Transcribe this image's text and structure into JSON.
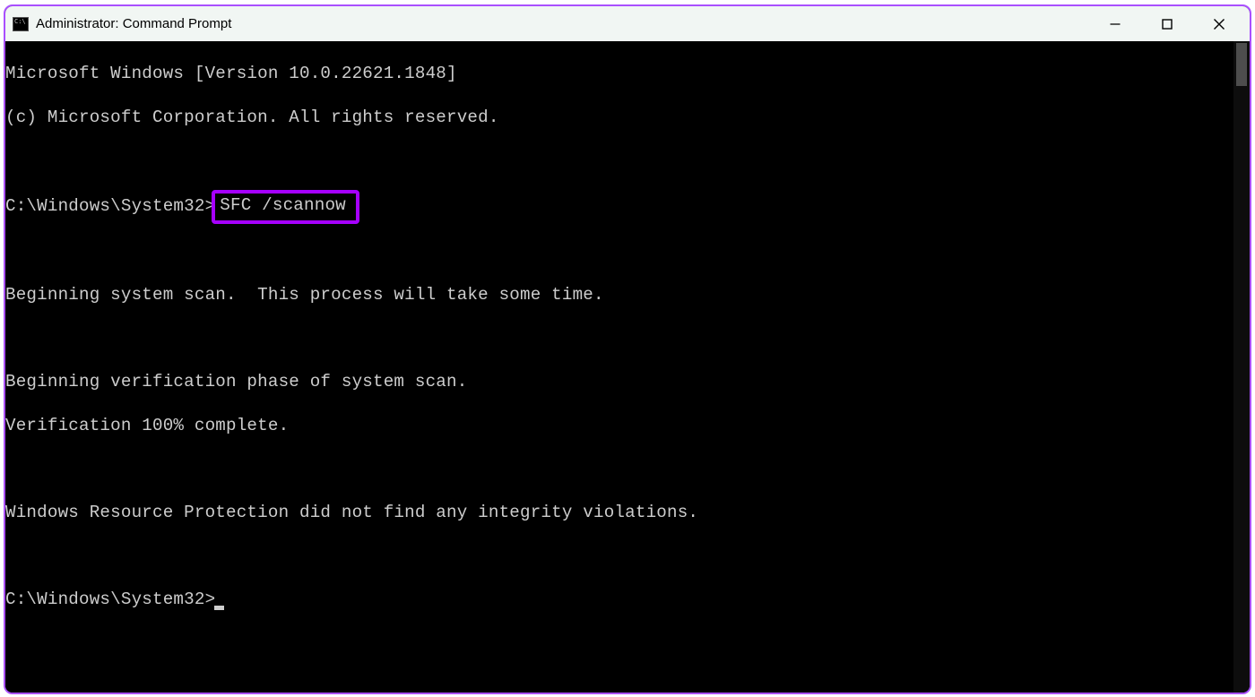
{
  "window": {
    "title": "Administrator: Command Prompt"
  },
  "terminal": {
    "header1": "Microsoft Windows [Version 10.0.22621.1848]",
    "header2": "(c) Microsoft Corporation. All rights reserved.",
    "prompt1_path": "C:\\Windows\\System32>",
    "command": "SFC /scannow",
    "out1": "Beginning system scan.  This process will take some time.",
    "out2": "Beginning verification phase of system scan.",
    "out3": "Verification 100% complete.",
    "out4": "Windows Resource Protection did not find any integrity violations.",
    "prompt2_path": "C:\\Windows\\System32>"
  }
}
